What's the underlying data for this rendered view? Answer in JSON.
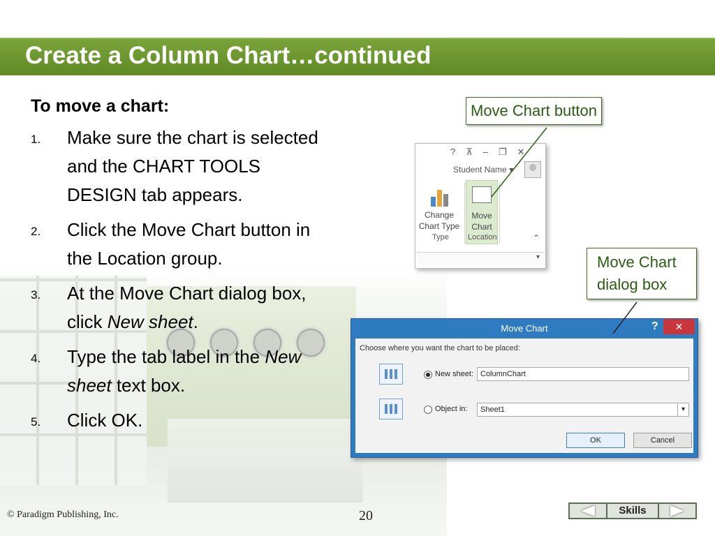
{
  "slide": {
    "title": "Create a Column Chart…continued",
    "heading": "To move a chart:",
    "steps": [
      {
        "num": "1.",
        "text": "Make sure the chart is selected and the CHART TOOLS DESIGN tab appears."
      },
      {
        "num": "2.",
        "text": "Click the Move Chart button in the Location group."
      },
      {
        "num": "3.",
        "pre": "At the Move Chart dialog box, click ",
        "em": "New sheet",
        "post": "."
      },
      {
        "num": "4.",
        "pre": "Type the tab label in the ",
        "em": "New sheet",
        "post": " text box."
      },
      {
        "num": "5.",
        "text": "Click OK."
      }
    ]
  },
  "callouts": {
    "move_chart_button": "Move Chart button",
    "dialog_box_line1": "Move Chart",
    "dialog_box_line2": "dialog box"
  },
  "ribbon": {
    "help": "?",
    "minimize": "–",
    "close": "✕",
    "user_name": "Student Name",
    "change_chart_type_line1": "Change",
    "change_chart_type_line2": "Chart Type",
    "move_chart_line1": "Move",
    "move_chart_line2": "Chart",
    "group_type": "Type",
    "group_location": "Location"
  },
  "dialog": {
    "title": "Move Chart",
    "help": "?",
    "close": "✕",
    "prompt": "Choose where you want the chart to be placed:",
    "new_sheet_label": "New sheet:",
    "new_sheet_value": "ColumnChart",
    "object_in_label": "Object in:",
    "object_in_value": "Sheet1",
    "ok_label": "OK",
    "cancel_label": "Cancel"
  },
  "footer": {
    "copyright": "© Paradigm Publishing, Inc.",
    "page_number": "20",
    "skills_label": "Skills"
  },
  "colors": {
    "title_bar": "#6b9630",
    "callout_text": "#2a5d12",
    "dialog_frame": "#2f7bbf",
    "dialog_close": "#c8373b"
  }
}
